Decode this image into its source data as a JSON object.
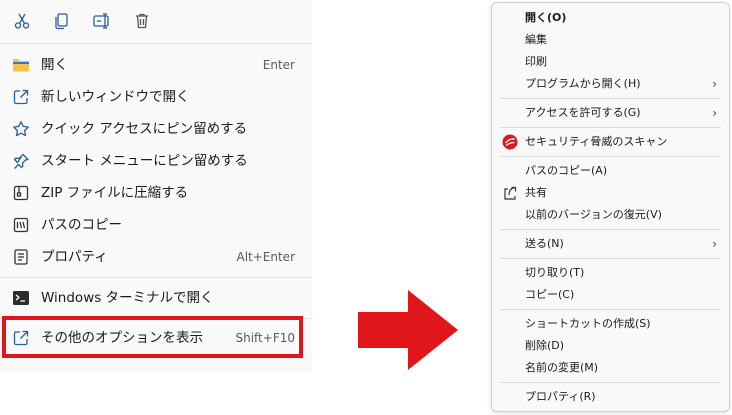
{
  "left_menu": {
    "quick_actions": [
      {
        "icon": "cut-icon"
      },
      {
        "icon": "copy-icon"
      },
      {
        "icon": "rename-icon"
      },
      {
        "icon": "delete-icon"
      }
    ],
    "items": [
      {
        "icon": "folder-icon",
        "label": "開く",
        "accel": "Enter"
      },
      {
        "icon": "new-window-icon",
        "label": "新しいウィンドウで開く",
        "accel": ""
      },
      {
        "icon": "star-icon",
        "label": "クイック アクセスにピン留めする",
        "accel": ""
      },
      {
        "icon": "pin-icon",
        "label": "スタート メニューにピン留めする",
        "accel": ""
      },
      {
        "icon": "zip-icon",
        "label": "ZIP ファイルに圧縮する",
        "accel": ""
      },
      {
        "icon": "copy-path-icon",
        "label": "パスのコピー",
        "accel": ""
      },
      {
        "icon": "properties-icon",
        "label": "プロパティ",
        "accel": "Alt+Enter"
      },
      {
        "icon": "terminal-icon",
        "label": "Windows ターミナルで開く",
        "accel": ""
      },
      {
        "icon": "more-options-icon",
        "label": "その他のオプションを表示",
        "accel": "Shift+F10"
      }
    ],
    "highlight_color": "#e0161b"
  },
  "arrow_color": "#e0161b",
  "right_menu": {
    "items": [
      {
        "label": "開く(O)",
        "bold": true,
        "submenu": false
      },
      {
        "label": "編集",
        "bold": false,
        "submenu": false
      },
      {
        "label": "印刷",
        "bold": false,
        "submenu": false
      },
      {
        "label": "プログラムから開く(H)",
        "bold": false,
        "submenu": true
      },
      {
        "label": "アクセスを許可する(G)",
        "bold": false,
        "submenu": true
      },
      {
        "label": "セキュリティ脅威のスキャン",
        "bold": false,
        "submenu": false,
        "icon": "security-scan-icon"
      },
      {
        "label": "パスのコピー(A)",
        "bold": false,
        "submenu": false
      },
      {
        "label": "共有",
        "bold": false,
        "submenu": false,
        "icon": "share-icon"
      },
      {
        "label": "以前のバージョンの復元(V)",
        "bold": false,
        "submenu": false
      },
      {
        "label": "送る(N)",
        "bold": false,
        "submenu": true
      },
      {
        "label": "切り取り(T)",
        "bold": false,
        "submenu": false
      },
      {
        "label": "コピー(C)",
        "bold": false,
        "submenu": false
      },
      {
        "label": "ショートカットの作成(S)",
        "bold": false,
        "submenu": false
      },
      {
        "label": "削除(D)",
        "bold": false,
        "submenu": false
      },
      {
        "label": "名前の変更(M)",
        "bold": false,
        "submenu": false
      },
      {
        "label": "プロパティ(R)",
        "bold": false,
        "submenu": false
      }
    ],
    "submenu_glyph": "›"
  }
}
